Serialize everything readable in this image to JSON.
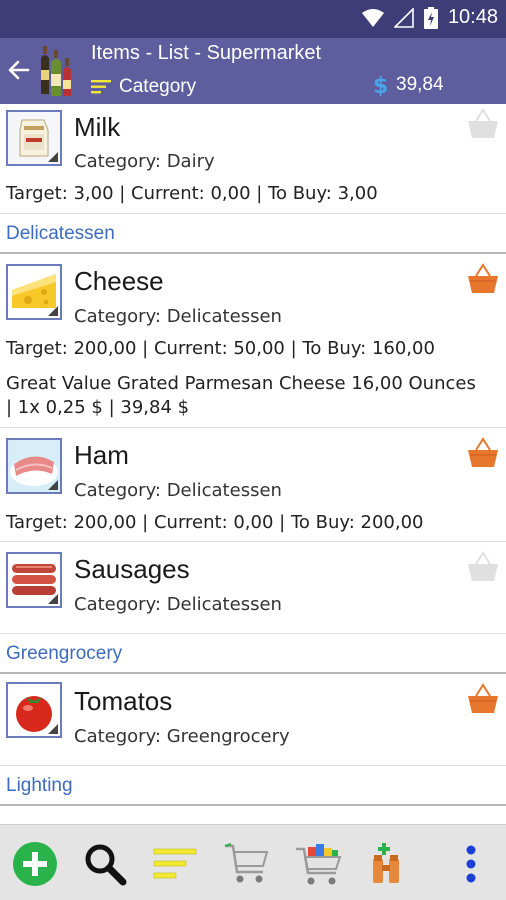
{
  "status_bar": {
    "time": "10:48",
    "icons": [
      "wifi-icon",
      "signal-icon",
      "battery-icon"
    ]
  },
  "app_bar": {
    "title": "Items - List - Supermarket",
    "sort_label": "Category",
    "total": "39,84",
    "icons": {
      "back": "back-arrow-icon",
      "logo": "bottles-icon",
      "sort": "sort-lines-icon",
      "currency": "dollar-icon"
    }
  },
  "list": {
    "milk": {
      "name": "Milk",
      "category": "Category: Dairy",
      "stock": "Target: 3,00 | Current: 0,00 | To Buy: 3,00",
      "in_basket": false
    },
    "section_delicatessen": "Delicatessen",
    "cheese": {
      "name": "Cheese",
      "category": "Category: Delicatessen",
      "stock": "Target: 200,00 | Current: 50,00 | To Buy: 160,00",
      "product_line1": "Great Value Grated Parmesan Cheese 16,00 Ounces",
      "product_line2": "| 1x 0,25 $ | 39,84 $",
      "in_basket": true
    },
    "ham": {
      "name": "Ham",
      "category": "Category: Delicatessen",
      "stock": "Target: 200,00 | Current: 0,00 | To Buy: 200,00",
      "in_basket": true
    },
    "sausages": {
      "name": "Sausages",
      "category": "Category: Delicatessen",
      "in_basket": false
    },
    "section_greengrocery": "Greengrocery",
    "tomatos": {
      "name": "Tomatos",
      "category": "Category: Greengrocery",
      "in_basket": true
    },
    "section_lighting": "Lighting"
  },
  "toolbar": {
    "buttons": [
      "add-icon",
      "search-icon",
      "sort-icon",
      "empty-cart-icon",
      "full-cart-icon",
      "binoculars-add-icon",
      "more-vert-icon"
    ]
  },
  "colors": {
    "status_bar": "#3e3d78",
    "app_bar": "#5e5d9e",
    "section_text": "#3d6bbf",
    "basket_active": "#e8772e",
    "basket_inactive": "#e0e0e0",
    "add_button": "#2bb34b",
    "sort_lines": "#f3e832"
  }
}
